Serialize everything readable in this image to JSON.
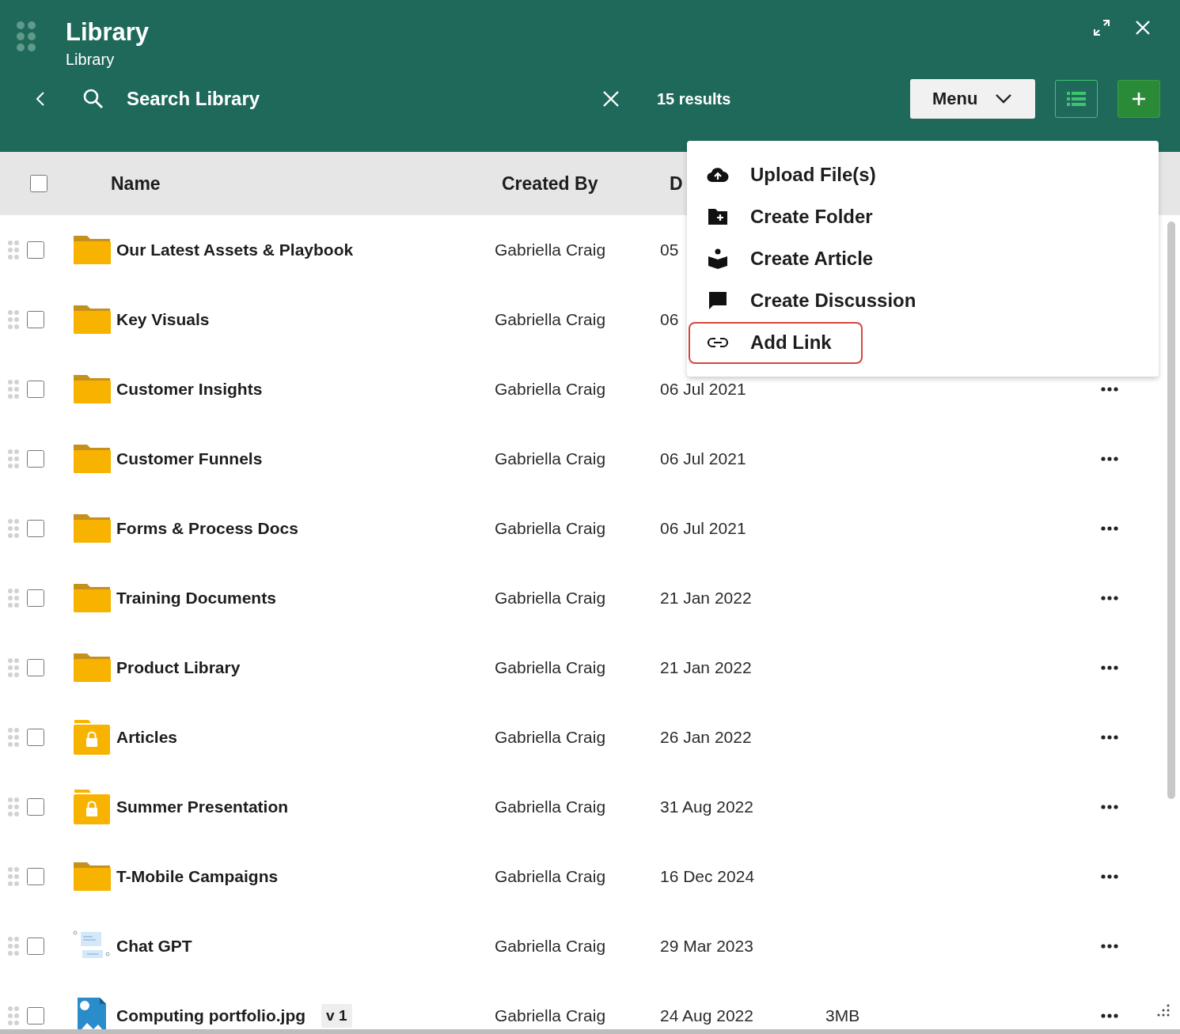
{
  "window": {
    "title": "Library",
    "subtitle": "Library"
  },
  "toolbar": {
    "search_value": "Search Library",
    "results": "15 results",
    "menu_button": "Menu"
  },
  "table": {
    "header_checked": false,
    "columns": [
      "Name",
      "Created By",
      "D"
    ],
    "rows": [
      {
        "kind": "folder",
        "name": "Our Latest Assets & Playbook",
        "created_by": "Gabriella Craig",
        "date": "05",
        "checked": false,
        "actions": false
      },
      {
        "kind": "folder",
        "name": "Key Visuals",
        "created_by": "Gabriella Craig",
        "date": "06",
        "checked": false,
        "actions": false
      },
      {
        "kind": "folder",
        "name": "Customer Insights",
        "created_by": "Gabriella Craig",
        "date": "06 Jul 2021",
        "checked": false,
        "actions": true
      },
      {
        "kind": "folder",
        "name": "Customer Funnels",
        "created_by": "Gabriella Craig",
        "date": "06 Jul 2021",
        "checked": false,
        "actions": true
      },
      {
        "kind": "folder",
        "name": "Forms & Process Docs",
        "created_by": "Gabriella Craig",
        "date": "06 Jul 2021",
        "checked": false,
        "actions": true
      },
      {
        "kind": "folder",
        "name": "Training Documents",
        "created_by": "Gabriella Craig",
        "date": "21 Jan 2022",
        "checked": false,
        "actions": true
      },
      {
        "kind": "folder",
        "name": "Product Library",
        "created_by": "Gabriella Craig",
        "date": "21 Jan 2022",
        "checked": false,
        "actions": true
      },
      {
        "kind": "locked-folder",
        "name": "Articles",
        "created_by": "Gabriella Craig",
        "date": "26 Jan 2022",
        "checked": false,
        "actions": true
      },
      {
        "kind": "locked-folder",
        "name": "Summer Presentation",
        "created_by": "Gabriella Craig",
        "date": "31 Aug 2022",
        "checked": false,
        "actions": true
      },
      {
        "kind": "folder",
        "name": "T-Mobile Campaigns",
        "created_by": "Gabriella Craig",
        "date": "16 Dec 2024",
        "checked": false,
        "actions": true
      },
      {
        "kind": "chat",
        "name": "Chat GPT",
        "created_by": "Gabriella Craig",
        "date": "29 Mar 2023",
        "checked": false,
        "actions": true
      },
      {
        "kind": "image",
        "name": "Computing portfolio.jpg",
        "version": "v 1",
        "created_by": "Gabriella Craig",
        "date": "24 Aug 2022",
        "size": "3MB",
        "checked": false,
        "actions": true
      }
    ]
  },
  "menu": {
    "items": [
      {
        "kind": "upload",
        "label": "Upload File(s)",
        "highlighted": false
      },
      {
        "kind": "folder",
        "label": "Create Folder",
        "highlighted": false
      },
      {
        "kind": "article",
        "label": "Create Article",
        "highlighted": false
      },
      {
        "kind": "discussion",
        "label": "Create Discussion",
        "highlighted": false
      },
      {
        "kind": "link",
        "label": "Add Link",
        "highlighted": true
      }
    ]
  }
}
